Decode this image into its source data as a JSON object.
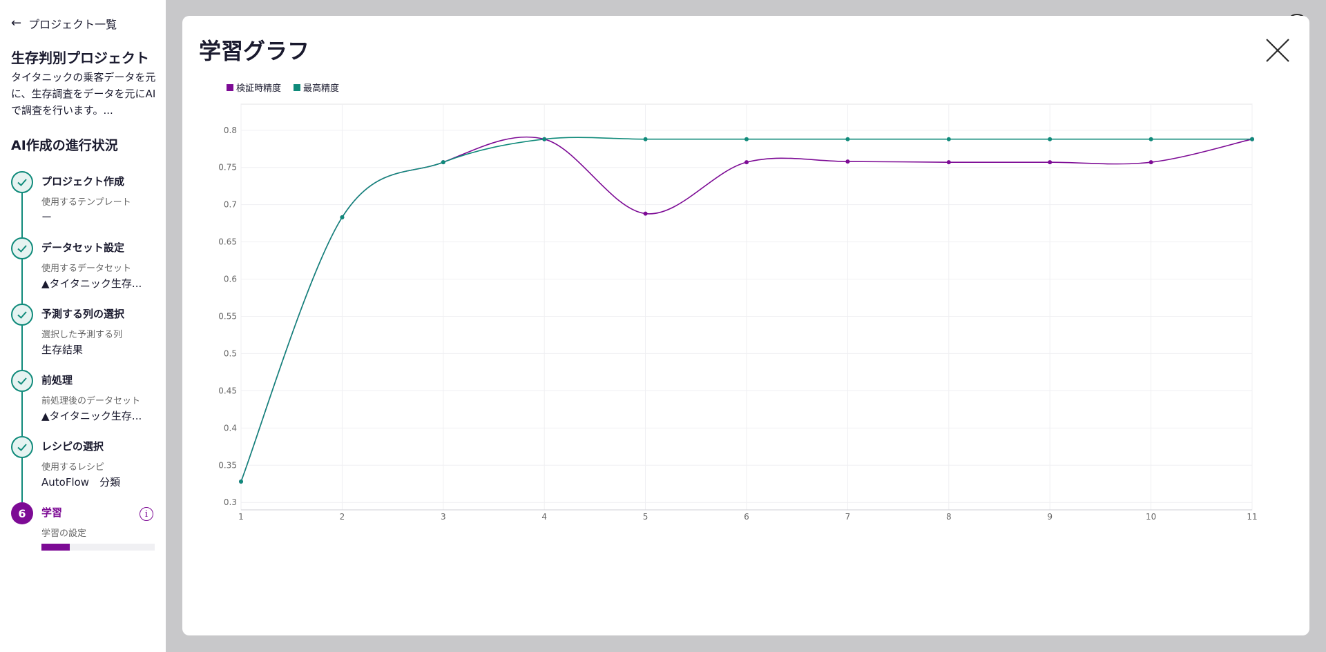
{
  "sidebar": {
    "back_label": "プロジェクト一覧",
    "project_title": "生存判別プロジェクト",
    "project_description": "タイタニックの乗客データを元に、生存調査をデータを元にAIで調査を行います。...",
    "progress_title": "AI作成の進行状況",
    "steps": [
      {
        "title": "プロジェクト作成",
        "sub": "使用するテンプレート",
        "value": "ー"
      },
      {
        "title": "データセット設定",
        "sub": "使用するデータセット",
        "value": "▲タイタニック生存..."
      },
      {
        "title": "予測する列の選択",
        "sub": "選択した予測する列",
        "value": "生存結果"
      },
      {
        "title": "前処理",
        "sub": "前処理後のデータセット",
        "value": "▲タイタニック生存..."
      },
      {
        "title": "レシピの選択",
        "sub": "使用するレシピ",
        "value": "AutoFlow　分類"
      },
      {
        "number": "6",
        "title": "学習",
        "sub": "学習の設定",
        "progress": 0.25
      }
    ],
    "info_icon": "info-icon"
  },
  "modal": {
    "title": "学習グラフ",
    "close_icon": "close-icon",
    "help_icon": "help-icon",
    "help_glyph": "?"
  },
  "colors": {
    "accent_purple": "#7d0b95",
    "accent_teal": "#0f8a7a"
  },
  "chart_data": {
    "type": "line",
    "x": [
      1,
      2,
      3,
      4,
      5,
      6,
      7,
      8,
      9,
      10,
      11
    ],
    "series": [
      {
        "name": "検証時精度",
        "color": "#7d0b95",
        "values": [
          0.328,
          0.683,
          0.757,
          0.788,
          0.688,
          0.757,
          0.758,
          0.757,
          0.757,
          0.757,
          0.788
        ]
      },
      {
        "name": "最高精度",
        "color": "#0f8a7a",
        "values": [
          0.328,
          0.683,
          0.757,
          0.788,
          0.788,
          0.788,
          0.788,
          0.788,
          0.788,
          0.788,
          0.788
        ]
      }
    ],
    "yticks": [
      "0.3",
      "0.35",
      "0.4",
      "0.45",
      "0.5",
      "0.55",
      "0.6",
      "0.65",
      "0.7",
      "0.75",
      "0.8"
    ],
    "xticks": [
      "1",
      "2",
      "3",
      "4",
      "5",
      "6",
      "7",
      "8",
      "9",
      "10",
      "11"
    ],
    "ylim": [
      0.29,
      0.835
    ],
    "xlim": [
      1,
      11
    ],
    "grid": true,
    "legend": "top-left"
  }
}
